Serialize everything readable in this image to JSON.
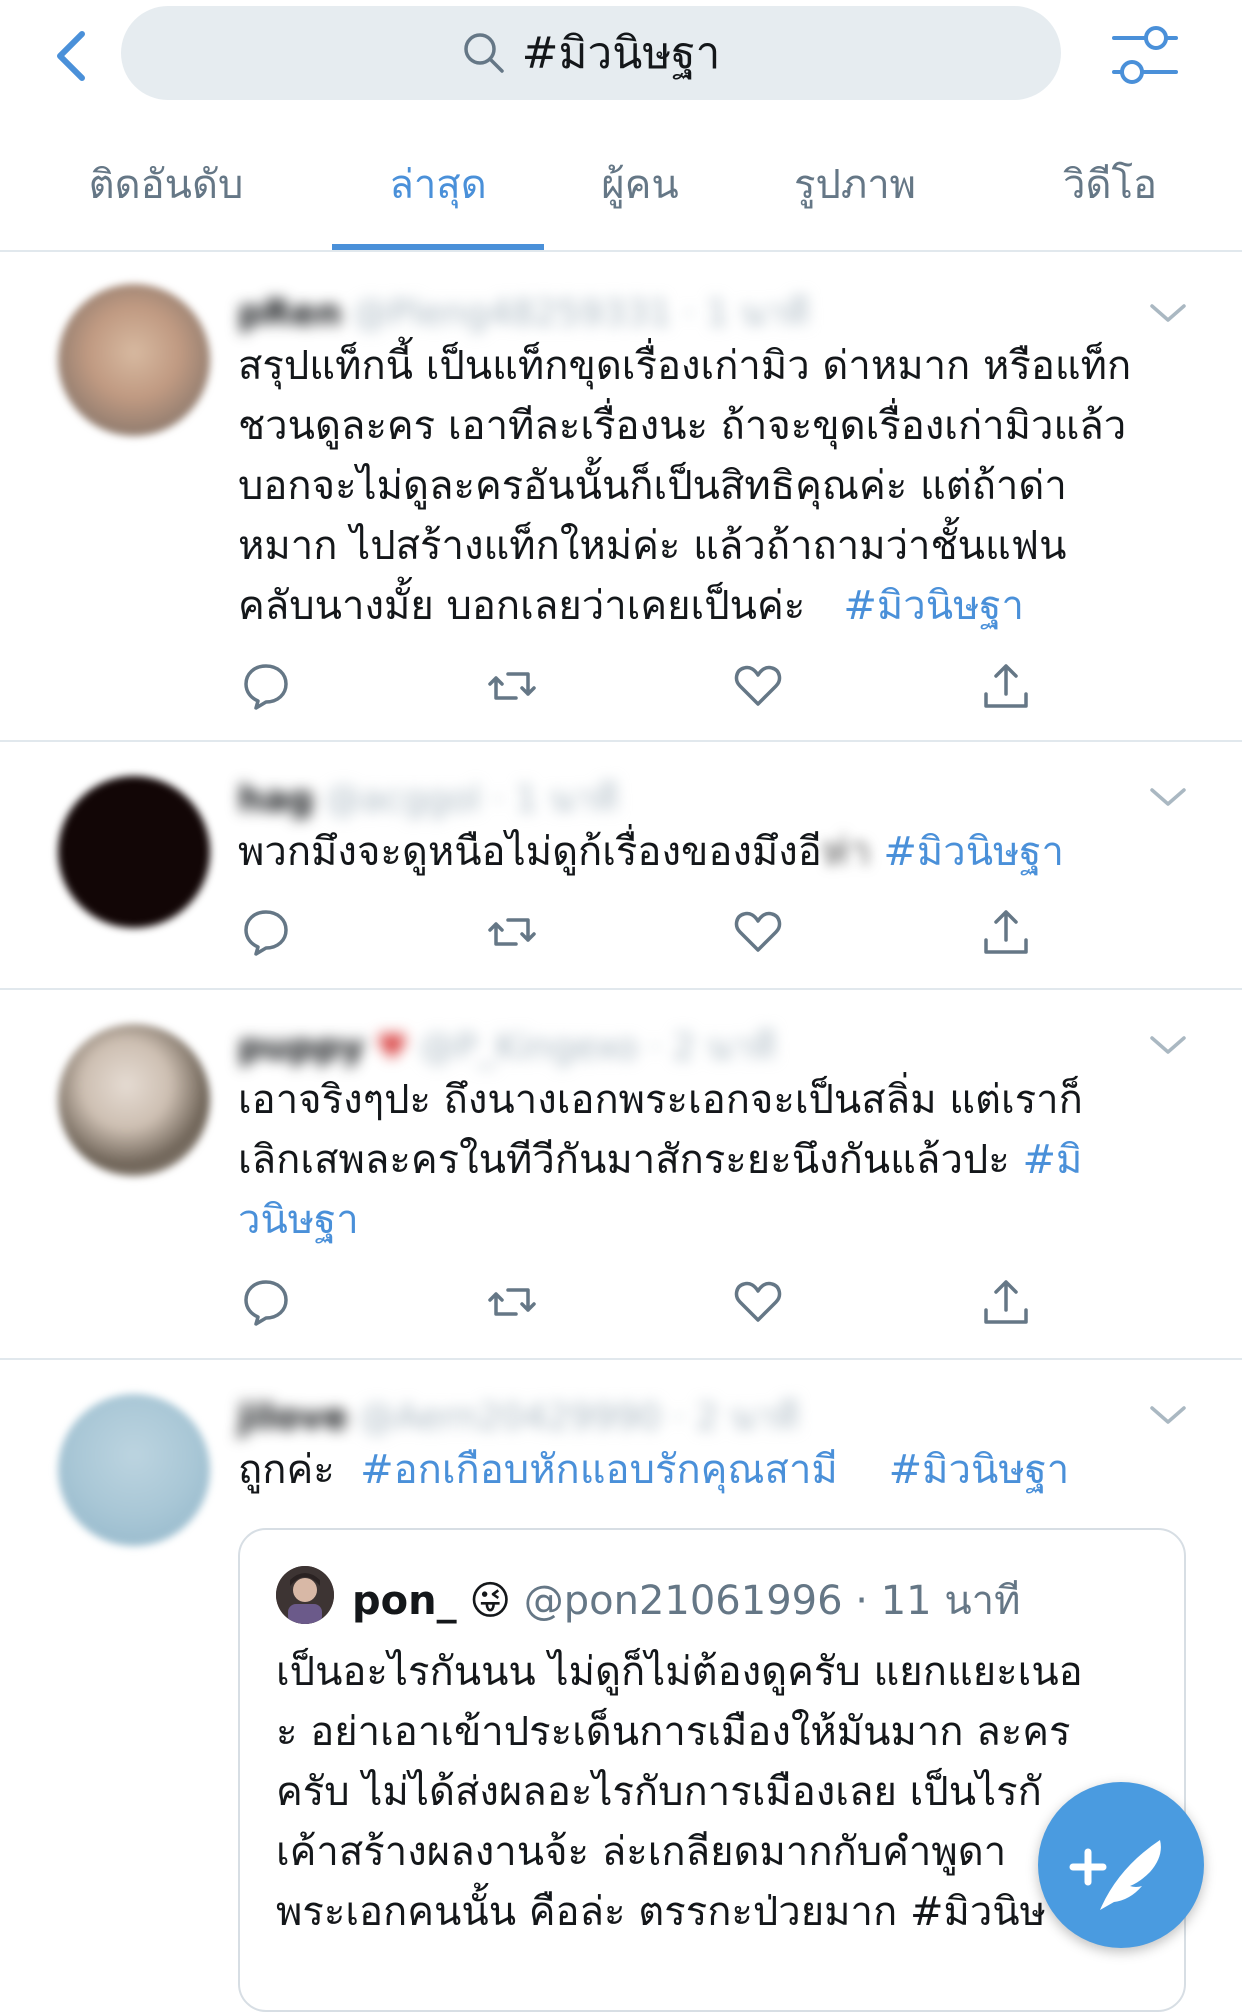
{
  "search": {
    "query": "#มิวนิษฐา"
  },
  "tabs": [
    {
      "label": "ติดอันดับ"
    },
    {
      "label": "ล่าสุด"
    },
    {
      "label": "ผู้คน"
    },
    {
      "label": "รูปภาพ"
    },
    {
      "label": "วิดีโอ"
    }
  ],
  "tweets": [
    {
      "name": "pRen",
      "handle": "@Pleng48259331",
      "time": "1 นาที",
      "text": "สรุปแท็กนี้ เป็นแท็กขุดเรื่องเก่ามิว ด่าหมาก หรือแท็กชวนดูละคร เอาทีละเรื่องนะ ถ้าจะขุดเรื่องเก่ามิวแล้ว บอกจะไม่ดูละครอันนั้นก็เป็นสิทธิคุณค่ะ แต่ถ้าด่า หมาก ไปสร้างแท็กใหม่ค่ะ แล้วถ้าถามว่าชั้นแฟน คลับนางมั้ย บอกเลยว่าเคยเป็นค่ะ",
      "lines": [
        "สรุปแท็กนี้ เป็นแท็กขุดเรื่องเก่ามิว ด่าหมาก หรือแท็ก",
        "ชวนดูละคร เอาทีละเรื่องนะ ถ้าจะขุดเรื่องเก่ามิวแล้ว",
        "บอกจะไม่ดูละครอันนั้นก็เป็นสิทธิคุณค่ะ แต่ถ้าด่า",
        "หมาก ไปสร้างแท็กใหม่ค่ะ แล้วถ้าถามว่าชั้นแฟน",
        "คลับนางมั้ย บอกเลยว่าเคยเป็นค่ะ"
      ],
      "tag": "#มิวนิษฐา"
    },
    {
      "name": "hag",
      "handle": "@acggol",
      "time": "1 นาที",
      "line": "พวกมึงจะดูหนือไม่ดูก้เรื่องของมึงอี",
      "blurred": "ห่า",
      "tag": "#มิวนิษฐา"
    },
    {
      "name": "puppy",
      "handle": "@P_Kingexo",
      "time": "2 นาที",
      "lines": [
        "เอาจริงๆปะ ถึงนางเอกพระเอกจะเป็นสลิ่ม แต่เราก็",
        "เลิกเสพละครในทีวีกันมาสักระยะนึงกันแล้วปะ"
      ],
      "tag_part1": "#มิ",
      "tag_part2": "วนิษฐา"
    },
    {
      "name": "jilove",
      "handle": "@Aern20429990",
      "time": "2 นาที",
      "line": "ถูกค่ะ",
      "tag1": "#อกเกือบหักแอบรักคุณสามี",
      "tag2": "#มิวนิษฐา",
      "quote": {
        "name": "pon_",
        "emoji": "😜",
        "handle": "@pon21061996",
        "dot": "·",
        "time": "11 นาที",
        "lines": [
          "เป็นอะไรกันนน ไม่ดูก็ไม่ต้องดูครับ แยกแยะเนอ",
          "ะ อย่าเอาเข้าประเด็นการเมืองให้มันมาก ละคร",
          "ครับ ไม่ได้ส่งผลอะไรกับการเมืองเลย เป็นไรกั",
          "เค้าสร้างผลงานจ้ะ ล่ะเกลียดมากกับคำพูดา",
          "พระเอกคนนั้น คือล่ะ ตรรกะป่วยมาก  #มิวนิษ"
        ]
      }
    }
  ],
  "colors": {
    "accent": "#4a90d9",
    "fab": "#4a9be0",
    "search_bg": "#e6ecf0"
  },
  "icons": [
    "back-chevron-icon",
    "search-icon",
    "filter-sliders-icon",
    "chevron-down-icon",
    "reply-icon",
    "retweet-icon",
    "like-icon",
    "share-icon",
    "compose-tweet-icon"
  ]
}
